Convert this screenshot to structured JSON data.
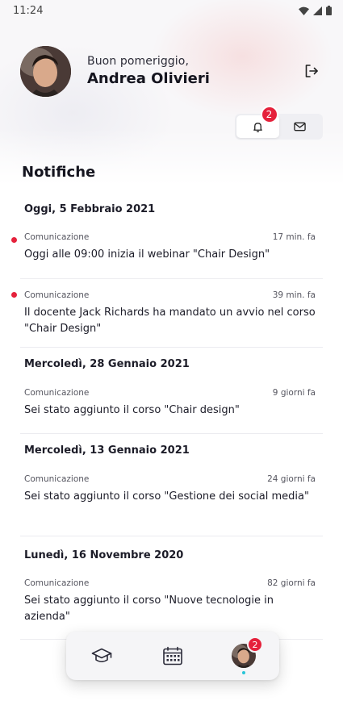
{
  "status_bar": {
    "time": "11:24"
  },
  "header": {
    "greeting": "Buon pomeriggio,",
    "name": "Andrea Olivieri"
  },
  "tabs": [
    {
      "name": "notifications",
      "icon": "bell-icon",
      "badge": "2",
      "active": true
    },
    {
      "name": "messages",
      "icon": "mail-icon",
      "active": false
    }
  ],
  "section_title": "Notifiche",
  "groups": [
    {
      "date": "Oggi, 5 Febbraio 2021",
      "items": [
        {
          "category": "Comunicazione",
          "time": "17 min. fa",
          "message": "Oggi alle 09:00 inizia il webinar \"Chair Design\"",
          "unread": true
        },
        {
          "category": "Comunicazione",
          "time": "39 min. fa",
          "message": "Il docente Jack Richards ha mandato un avvio nel corso \"Chair Design\"",
          "unread": true
        }
      ]
    },
    {
      "date": "Mercoledì, 28 Gennaio 2021",
      "items": [
        {
          "category": "Comunicazione",
          "time": "9 giorni fa",
          "message": "Sei stato aggiunto il corso \"Chair design\"",
          "unread": false
        }
      ]
    },
    {
      "date": "Mercoledì, 13 Gennaio 2021",
      "items": [
        {
          "category": "Comunicazione",
          "time": "24 giorni fa",
          "message": "Sei stato aggiunto il corso \"Gestione dei social media\"",
          "unread": false
        }
      ]
    },
    {
      "date": "Lunedì, 16 Novembre 2020",
      "items": [
        {
          "category": "Comunicazione",
          "time": "82 giorni fa",
          "message": "Sei stato aggiunto il corso \"Nuove tecnologie in azienda\"",
          "unread": false
        }
      ]
    }
  ],
  "bottom_nav": {
    "items": [
      {
        "name": "courses",
        "icon": "graduation-cap-icon"
      },
      {
        "name": "calendar",
        "icon": "calendar-icon"
      },
      {
        "name": "profile",
        "icon": "avatar",
        "badge": "2",
        "active": true
      }
    ]
  },
  "colors": {
    "accent_red": "#e5213b",
    "active_dot": "#28c5d8",
    "text": "#1c1c28"
  }
}
